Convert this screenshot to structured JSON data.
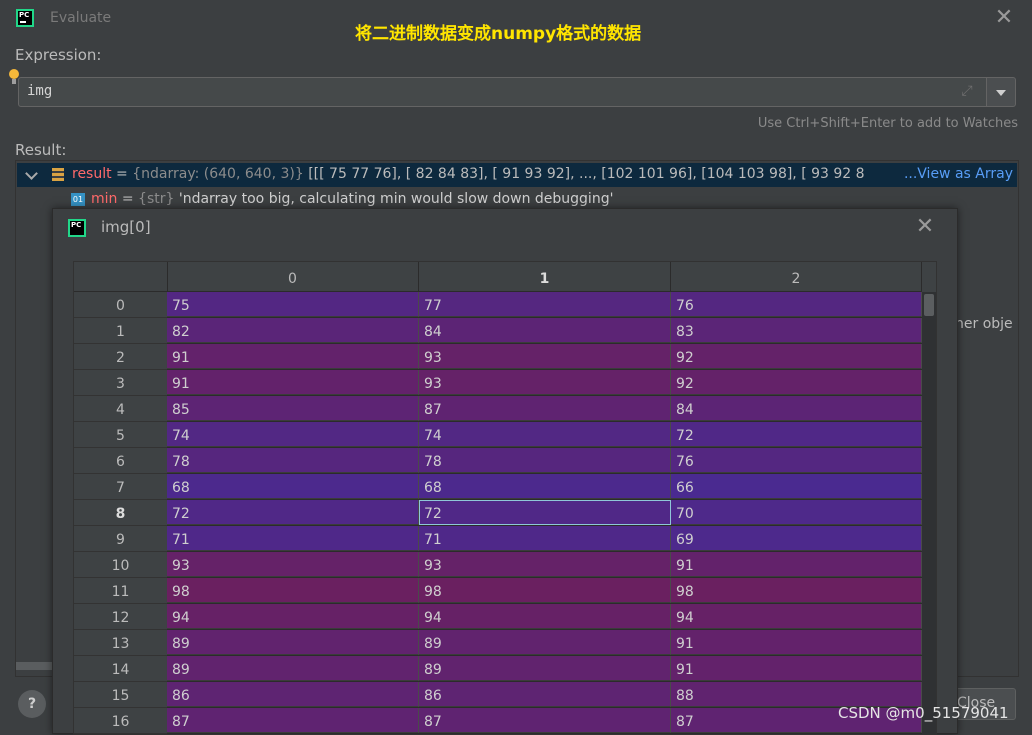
{
  "window": {
    "title": "Evaluate",
    "app_icon_text": "PC",
    "annotation": "将二进制数据变成numpy格式的数据"
  },
  "expression": {
    "label": "Expression:",
    "value": "img",
    "hint": "Use Ctrl+Shift+Enter to add to Watches"
  },
  "result": {
    "label": "Result:",
    "name": "result",
    "eq": " = ",
    "type": "{ndarray: (640, 640, 3)}",
    "preview": " [[[ 75  77  76],  [ 82  84  83],  [ 91  93  92],  ...,  [102 101  96],  [104 103  98],  [ 93  92  8",
    "view_array": "...View as Array",
    "min_name": "min",
    "min_type": "{str}",
    "min_value": " 'ndarray too big, calculating min would slow down debugging'",
    "min_icon_text": "01",
    "bg_fragment": "ner obje"
  },
  "buttons": {
    "help": "?",
    "close": "Close"
  },
  "popup": {
    "title": "img[0]",
    "columns": [
      "0",
      "1",
      "2"
    ],
    "active_column": "1",
    "active_row": 8,
    "selected_cell": {
      "row": 8,
      "col": 1
    },
    "rows": [
      {
        "index": "0",
        "values": [
          75,
          77,
          76
        ]
      },
      {
        "index": "1",
        "values": [
          82,
          84,
          83
        ]
      },
      {
        "index": "2",
        "values": [
          91,
          93,
          92
        ]
      },
      {
        "index": "3",
        "values": [
          91,
          93,
          92
        ]
      },
      {
        "index": "4",
        "values": [
          85,
          87,
          84
        ]
      },
      {
        "index": "5",
        "values": [
          74,
          74,
          72
        ]
      },
      {
        "index": "6",
        "values": [
          78,
          78,
          76
        ]
      },
      {
        "index": "7",
        "values": [
          68,
          68,
          66
        ]
      },
      {
        "index": "8",
        "values": [
          72,
          72,
          70
        ]
      },
      {
        "index": "9",
        "values": [
          71,
          71,
          69
        ]
      },
      {
        "index": "10",
        "values": [
          93,
          93,
          91
        ]
      },
      {
        "index": "11",
        "values": [
          98,
          98,
          98
        ]
      },
      {
        "index": "12",
        "values": [
          94,
          94,
          94
        ]
      },
      {
        "index": "13",
        "values": [
          89,
          89,
          91
        ]
      },
      {
        "index": "14",
        "values": [
          89,
          89,
          91
        ]
      },
      {
        "index": "15",
        "values": [
          86,
          86,
          88
        ]
      },
      {
        "index": "16",
        "values": [
          87,
          87,
          87
        ]
      }
    ],
    "colors": {
      "low": "#4a2a90",
      "high": "#6a2060"
    }
  },
  "watermark": "CSDN @m0_51579041"
}
